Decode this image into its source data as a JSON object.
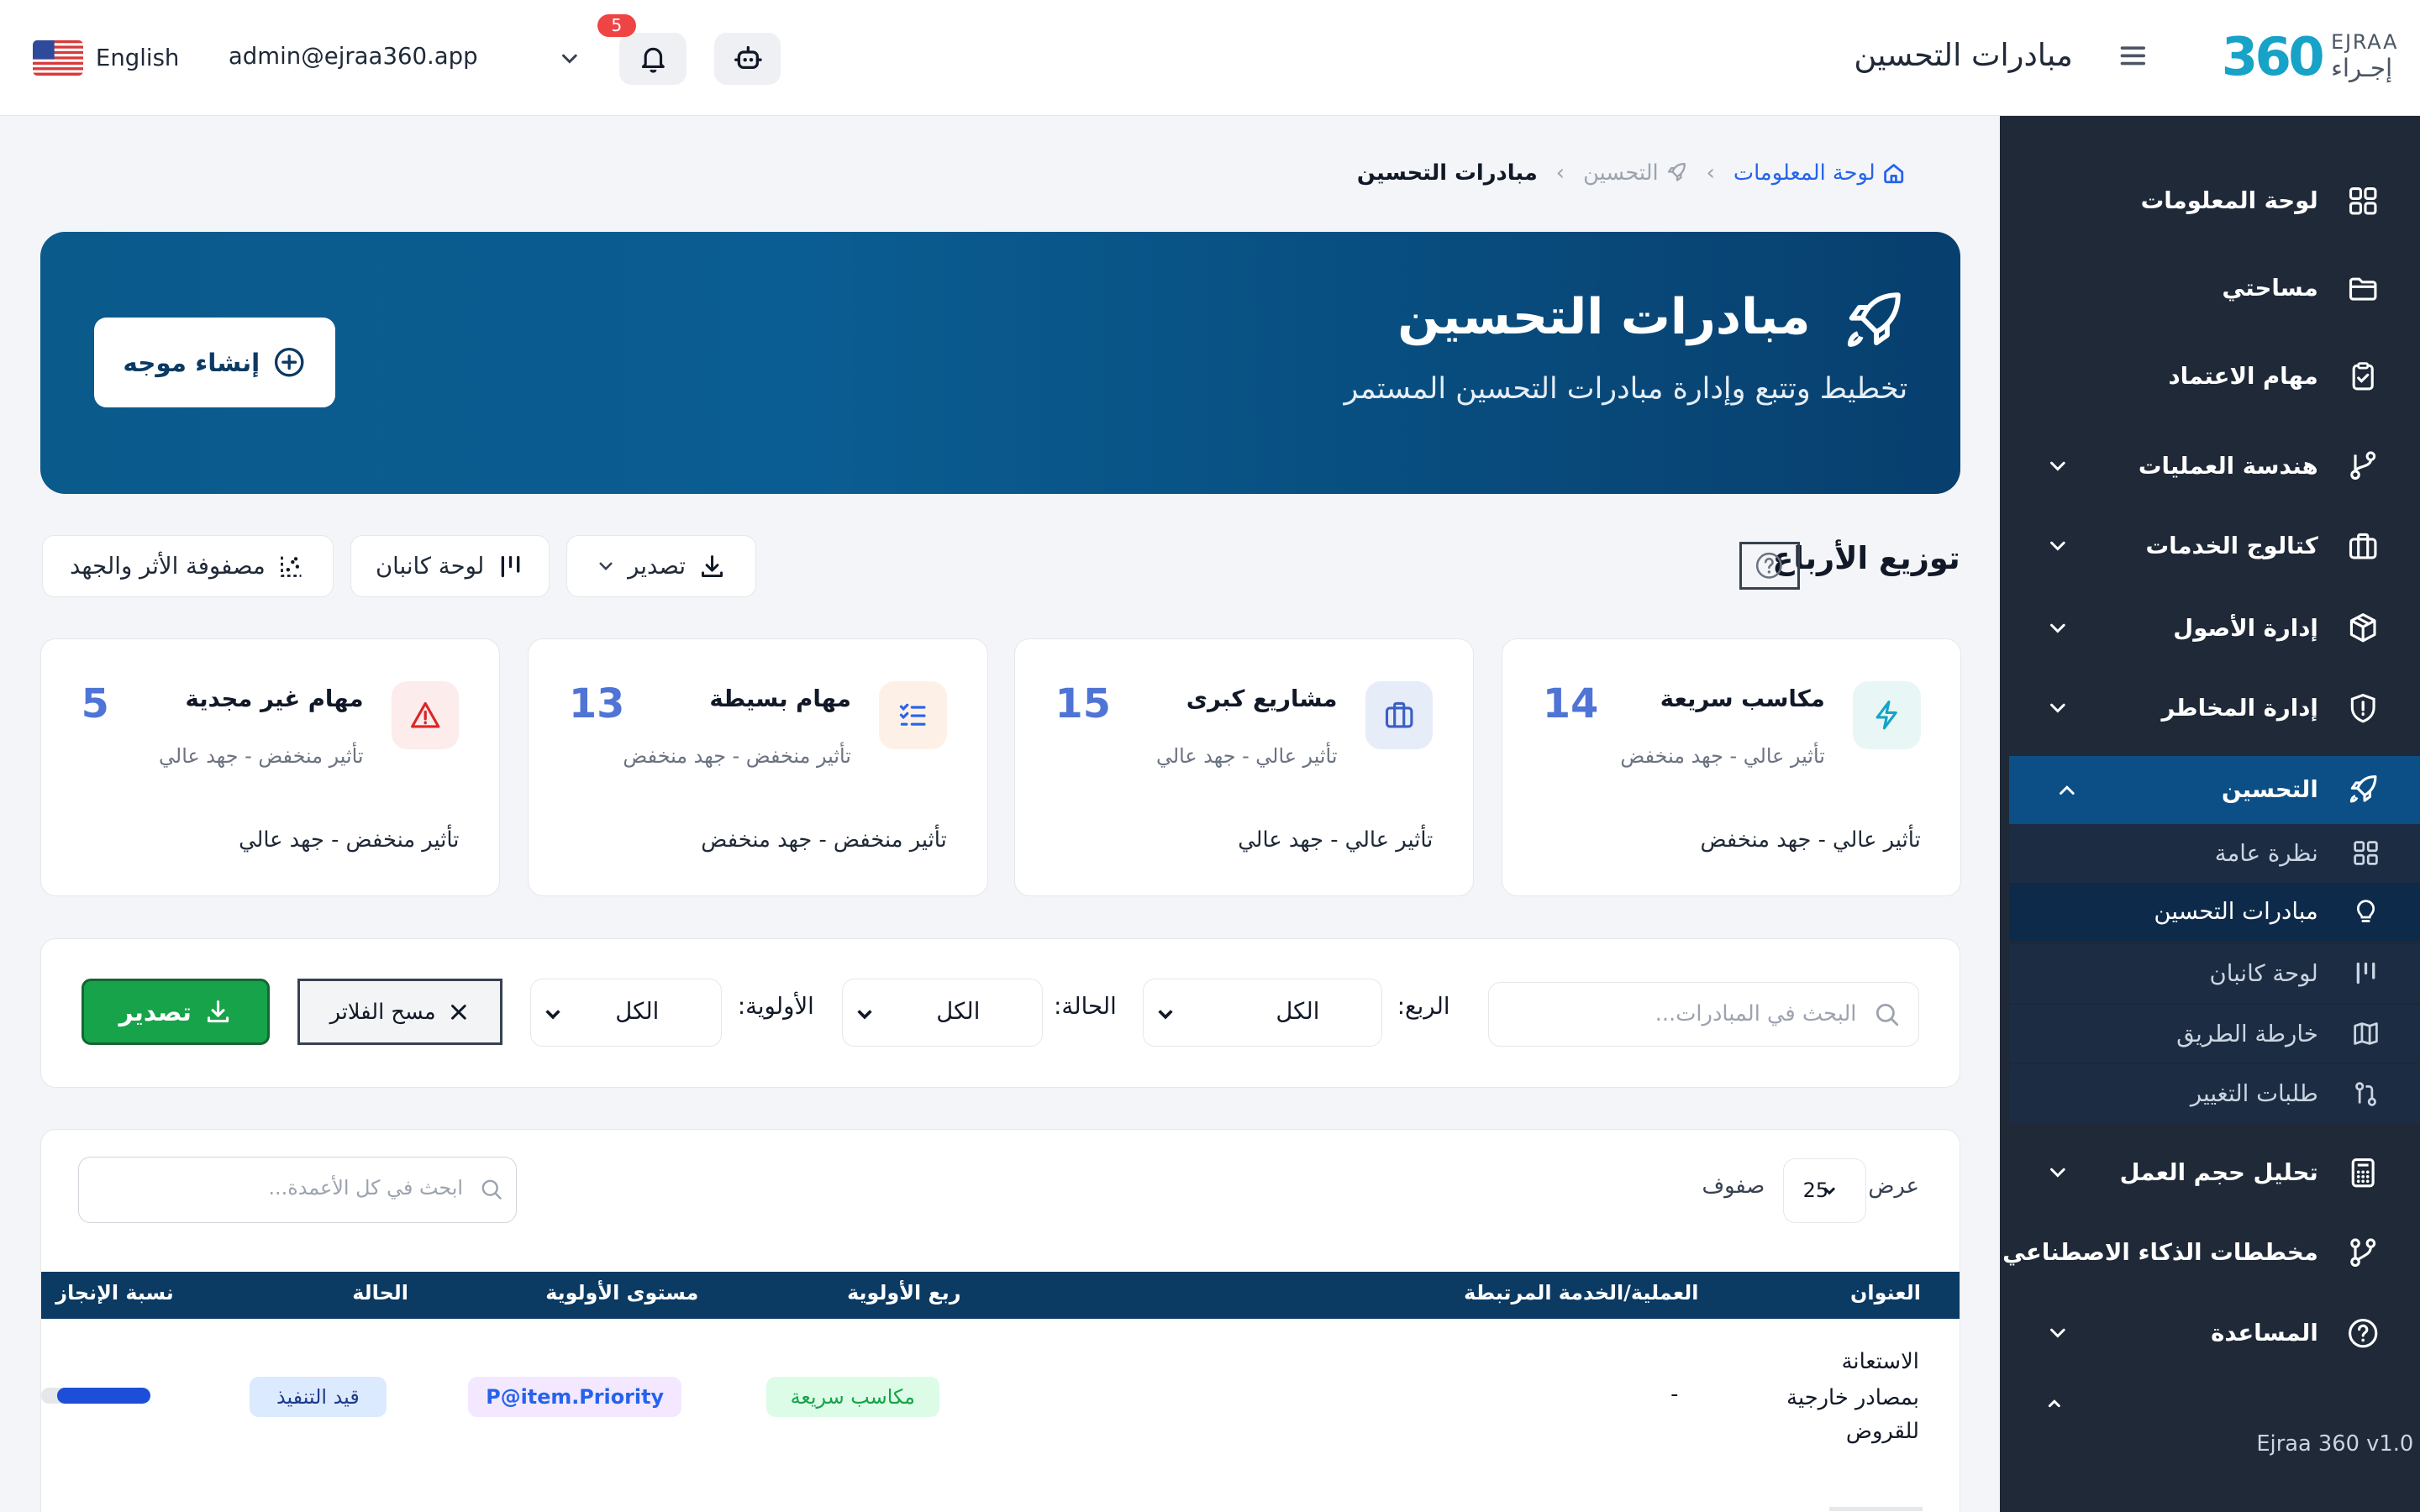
{
  "header": {
    "logo_brand": "EJRAA",
    "logo_number": "360",
    "logo_arabic": "إجـراء",
    "title": "مبادرات التحسين",
    "notifications_count": "5",
    "user_email": "admin@ejraa360.app",
    "language": "English"
  },
  "sidebar": {
    "items": [
      {
        "label": "لوحة المعلومات",
        "icon": "grid-icon"
      },
      {
        "label": "مساحتي",
        "icon": "folder-icon"
      },
      {
        "label": "مهام الاعتماد",
        "icon": "clipboard-check-icon"
      },
      {
        "label": "هندسة العمليات",
        "icon": "git-branch-icon"
      },
      {
        "label": "كتالوج الخدمات",
        "icon": "briefcase-icon"
      },
      {
        "label": "إدارة الأصول",
        "icon": "box-icon"
      },
      {
        "label": "إدارة المخاطر",
        "icon": "shield-icon"
      },
      {
        "label": "التحسين",
        "icon": "rocket-icon"
      },
      {
        "label": "تحليل حجم العمل",
        "icon": "calculator-icon"
      },
      {
        "label": "مخططات الذكاء الاصطناعي",
        "icon": "git-diagram-icon"
      },
      {
        "label": "المساعدة",
        "icon": "help-circle-icon"
      }
    ],
    "subitems": [
      {
        "label": "نظرة عامة",
        "icon": "grid-icon"
      },
      {
        "label": "مبادرات التحسين",
        "icon": "lightbulb-icon"
      },
      {
        "label": "لوحة كانبان",
        "icon": "kanban-icon"
      },
      {
        "label": "خارطة الطريق",
        "icon": "map-icon"
      },
      {
        "label": "طلبات التغيير",
        "icon": "change-request-icon"
      }
    ],
    "version": "Ejraa 360 v1.0"
  },
  "breadcrumb": {
    "home": "لوحة المعلومات",
    "section": "التحسين",
    "current": "مبادرات التحسين"
  },
  "hero": {
    "title": "مبادرات التحسين",
    "subtitle": "تخطيط وتتبع وإدارة مبادرات التحسين المستمر",
    "create_button": "إنشاء موجه"
  },
  "quadrants": {
    "title": "توزيع الأرباع",
    "export_label": "تصدير",
    "kanban_label": "لوحة كانبان",
    "matrix_label": "مصفوفة الأثر والجهد",
    "cards": [
      {
        "title": "مكاسب سريعة",
        "sub": "تأثير عالي - جهد منخفض",
        "count": "14",
        "footer": "تأثير عالي - جهد منخفض",
        "icon": "zap-icon",
        "color": "#16a3c7",
        "bg": "#e8f7f5"
      },
      {
        "title": "مشاريع كبرى",
        "sub": "تأثير عالي - جهد عالي",
        "count": "15",
        "footer": "تأثير عالي - جهد عالي",
        "icon": "briefcase-icon",
        "color": "#3b5fc4",
        "bg": "#e6edf8"
      },
      {
        "title": "مهام بسيطة",
        "sub": "تأثير منخفض - جهد منخفض",
        "count": "13",
        "footer": "تأثير منخفض - جهد منخفض",
        "icon": "list-check-icon",
        "color": "#2563eb",
        "bg": "#fdf1e7"
      },
      {
        "title": "مهام غير مجدية",
        "sub": "تأثير منخفض - جهد عالي",
        "count": "5",
        "footer": "تأثير منخفض - جهد عالي",
        "icon": "alert-triangle-icon",
        "color": "#dc2626",
        "bg": "#fdecec"
      }
    ]
  },
  "filters": {
    "search_placeholder": "البحث في المبادرات...",
    "quarter_label": "الربع:",
    "quarter_value": "الكل",
    "status_label": "الحالة:",
    "status_value": "الكل",
    "priority_label": "الأولوية:",
    "priority_value": "الكل",
    "clear_label": "مسح الفلاتر",
    "export_label": "تصدير"
  },
  "table": {
    "show_label": "عرض",
    "rows_value": "25",
    "rows_label": "صفوف",
    "search_placeholder": "ابحث في كل الأعمدة...",
    "columns": [
      "العنوان",
      "العملية/الخدمة المرتبطة",
      "ربع الأولوية",
      "مستوى الأولوية",
      "الحالة",
      "نسبة الإنجاز"
    ],
    "rows": [
      {
        "title_l1": "الاستعانة",
        "title_l2": "بمصادر خارجية",
        "title_l3": "للقروض",
        "process": "-",
        "quadrant": "مكاسب سريعة",
        "priority": "P@item.Priority",
        "status": "قيد التنفيذ",
        "progress": 0.85
      }
    ]
  }
}
